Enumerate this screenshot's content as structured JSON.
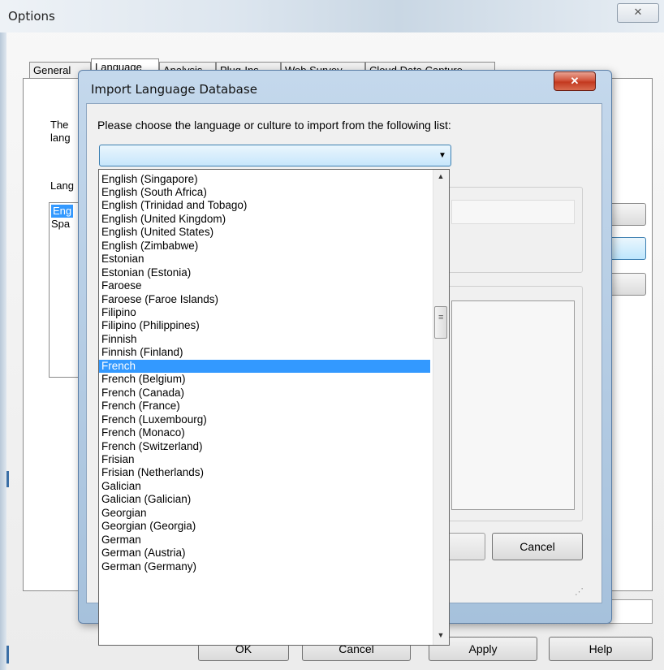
{
  "options_window": {
    "title": "Options",
    "close_glyph": "✕",
    "tabs": [
      "General",
      "Language",
      "Analysis",
      "Plug-Ins",
      "Web Survey",
      "Cloud Data Capture"
    ],
    "description_partial": "The lang",
    "languages_label_partial": "Lang",
    "languages_list": [
      "Eng",
      "Spa"
    ],
    "buttons": {
      "ok": "OK",
      "cancel": "Cancel",
      "apply": "Apply",
      "help": "Help"
    }
  },
  "import_dialog": {
    "title": "Import Language Database",
    "close_glyph": "✕",
    "prompt": "Please choose the language or culture to import from the following list:",
    "combo_value": "",
    "cancel_label": "Cancel",
    "selected_item": "French",
    "dropdown_items": [
      "English (Singapore)",
      "English (South Africa)",
      "English (Trinidad and Tobago)",
      "English (United Kingdom)",
      "English (United States)",
      "English (Zimbabwe)",
      "Estonian",
      "Estonian (Estonia)",
      "Faroese",
      "Faroese (Faroe Islands)",
      "Filipino",
      "Filipino (Philippines)",
      "Finnish",
      "Finnish (Finland)",
      "French",
      "French (Belgium)",
      "French (Canada)",
      "French (France)",
      "French (Luxembourg)",
      "French (Monaco)",
      "French (Switzerland)",
      "Frisian",
      "Frisian (Netherlands)",
      "Galician",
      "Galician (Galician)",
      "Georgian",
      "Georgian (Georgia)",
      "German",
      "German (Austria)",
      "German (Germany)"
    ]
  },
  "icons": {
    "dropdown_arrow": "▼",
    "scroll_up": "▲",
    "scroll_down": "▼",
    "resize_grip": "⋰"
  }
}
